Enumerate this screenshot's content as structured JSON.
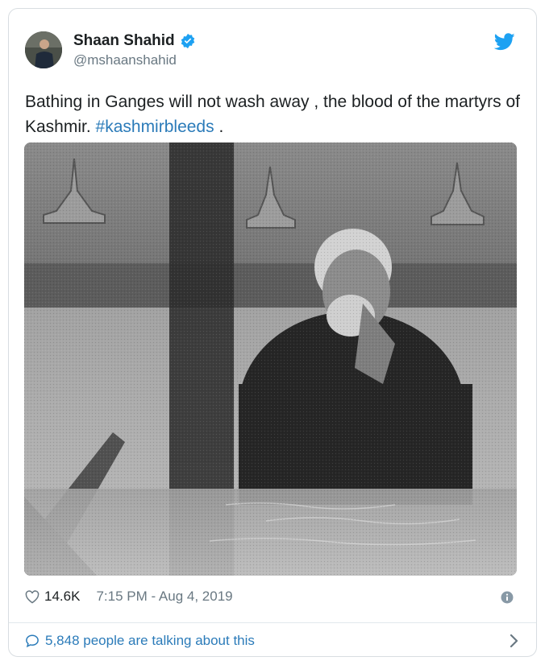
{
  "author": {
    "name": "Shaan Shahid",
    "handle": "@mshaanshahid",
    "verified": true
  },
  "tweet": {
    "text": "Bathing in Ganges will not wash away , the blood of the martyrs of Kashmir. ",
    "hashtag": "#kashmirbleeds",
    "suffix": " ."
  },
  "meta": {
    "likes": "14.6K",
    "timestamp": "7:15 PM - Aug 4, 2019"
  },
  "footer": {
    "talking": "5,848 people are talking about this"
  },
  "colors": {
    "link": "#2b7bb9",
    "twitter_blue": "#1da1f2",
    "muted": "#697882"
  },
  "icons": [
    "twitter-bird-icon",
    "verified-badge-icon",
    "heart-icon",
    "info-icon",
    "comment-bubble-icon",
    "chevron-right-icon"
  ]
}
